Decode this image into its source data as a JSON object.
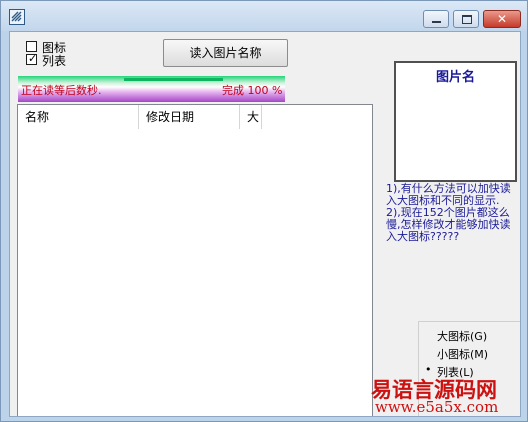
{
  "titlebar": {
    "title": ""
  },
  "options": {
    "icon_label": "图标",
    "list_label": "列表",
    "list_checked_mark": "✓"
  },
  "toolbar": {
    "read_button_label": "读入图片名称"
  },
  "progress": {
    "status_text": "正在读等后数秒.",
    "percent_text": "完成 100 %",
    "value": 100
  },
  "list": {
    "columns": [
      "名称",
      "修改日期",
      "大"
    ],
    "rows": []
  },
  "preview": {
    "title": "图片名"
  },
  "notes": [
    "1),有什么方法可以加快读入大图标和不同的显示.",
    "2),现在152个图片都这么慢,怎样修改才能够加快读入大图标?????"
  ],
  "view_menu": {
    "items": [
      "大图标(G)",
      "小图标(M)",
      "列表(L)"
    ],
    "selected": "列表(L)",
    "selected_mark": "•"
  },
  "watermark": {
    "brand": "易语言源码网",
    "url": "www.e5a5x.com"
  },
  "colors": {
    "title_bg": "#c2d6ec",
    "progress_text": "#c2001c",
    "notes_text": "#1a1a99",
    "watermark": "#cc1111"
  }
}
